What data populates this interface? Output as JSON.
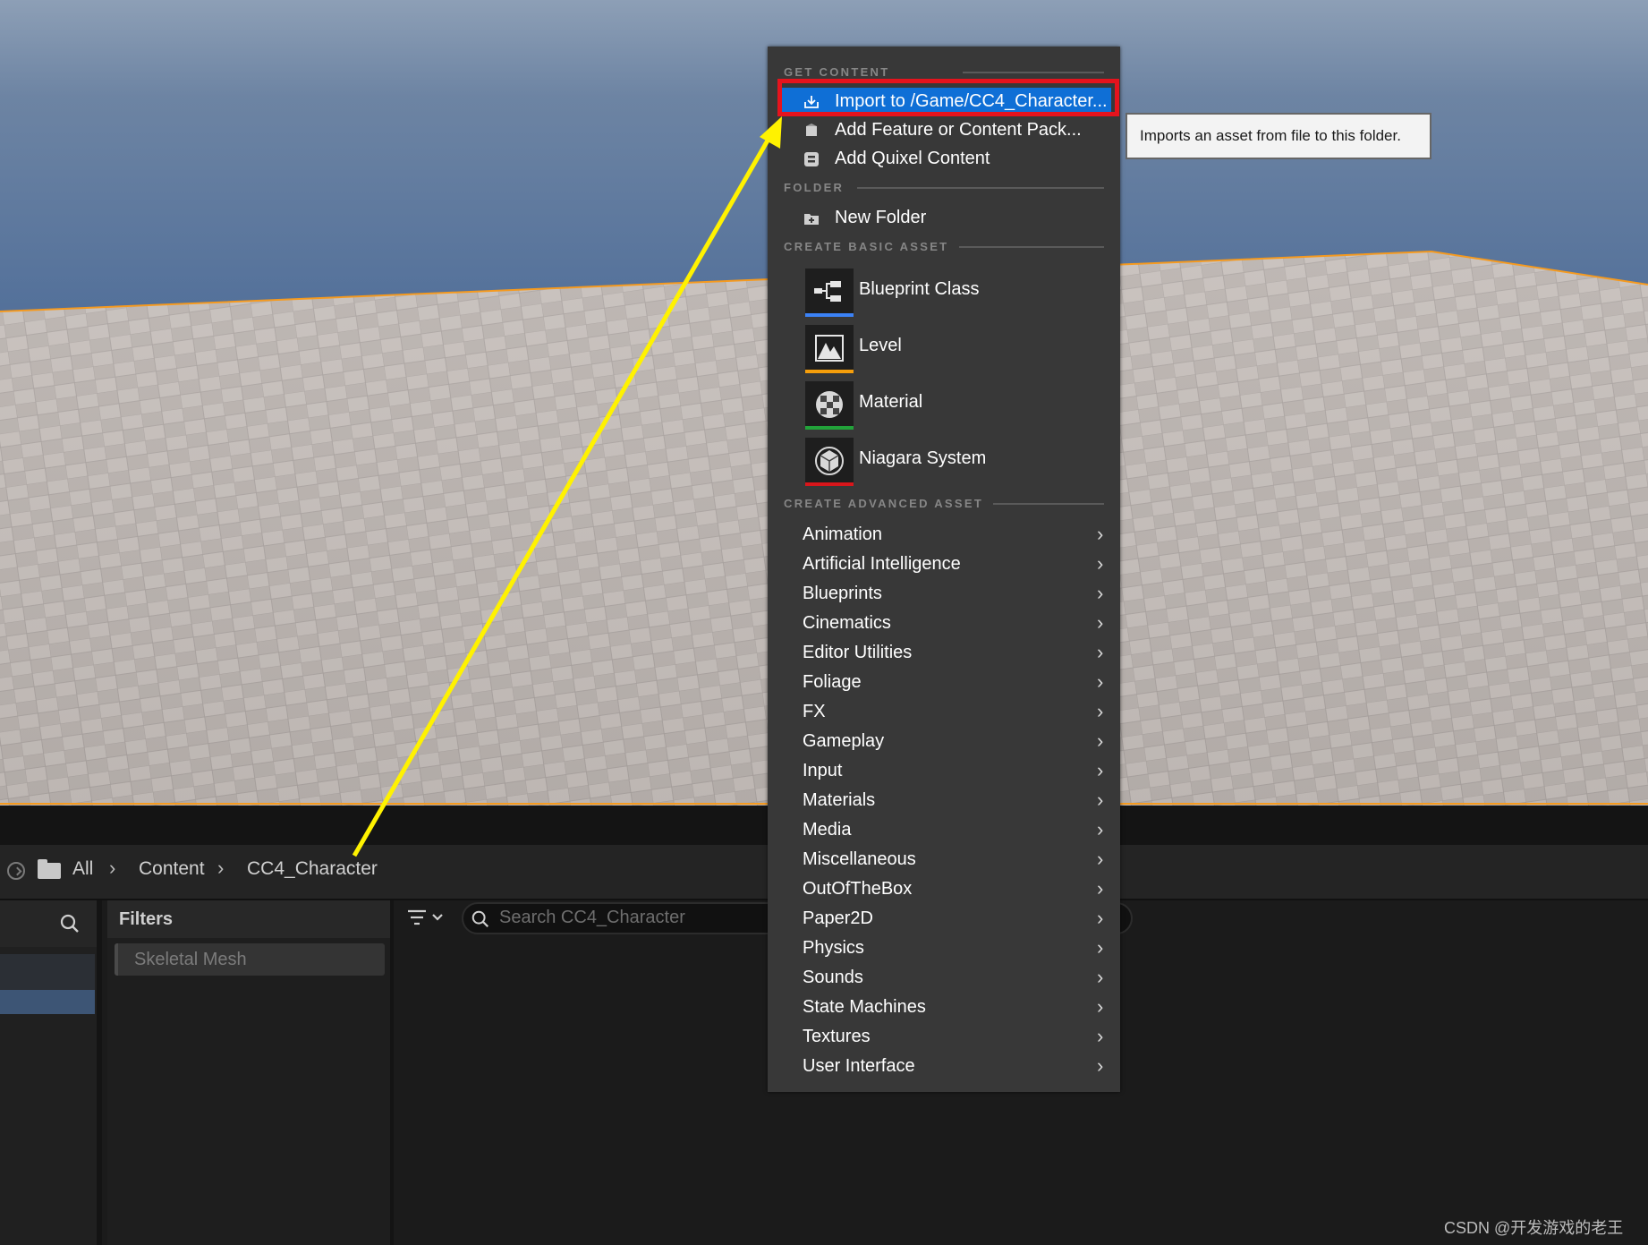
{
  "breadcrumb": {
    "items": [
      "All",
      "Content",
      "CC4_Character"
    ]
  },
  "filters": {
    "title": "Filters",
    "chip_label": "Skeletal Mesh"
  },
  "search": {
    "placeholder": "Search CC4_Character"
  },
  "context_menu": {
    "get_content_header": "GET CONTENT",
    "get_content": [
      {
        "label": "Import to /Game/CC4_Character...",
        "icon": "import-icon"
      },
      {
        "label": "Add Feature or Content Pack...",
        "icon": "content-pack-icon"
      },
      {
        "label": "Add Quixel Content",
        "icon": "quixel-icon"
      }
    ],
    "folder_header": "FOLDER",
    "folder": [
      {
        "label": "New Folder",
        "icon": "new-folder-icon"
      }
    ],
    "basic_asset_header": "CREATE BASIC ASSET",
    "basic_assets": [
      {
        "label": "Blueprint Class",
        "icon": "blueprint-class-icon",
        "color": "#3b82f6"
      },
      {
        "label": "Level",
        "icon": "level-icon",
        "color": "#f59e0b"
      },
      {
        "label": "Material",
        "icon": "material-icon",
        "color": "#22a33a"
      },
      {
        "label": "Niagara System",
        "icon": "niagara-icon",
        "color": "#d8161b"
      }
    ],
    "advanced_asset_header": "CREATE ADVANCED ASSET",
    "advanced_assets": [
      "Animation",
      "Artificial Intelligence",
      "Blueprints",
      "Cinematics",
      "Editor Utilities",
      "Foliage",
      "FX",
      "Gameplay",
      "Input",
      "Materials",
      "Media",
      "Miscellaneous",
      "OutOfTheBox",
      "Paper2D",
      "Physics",
      "Sounds",
      "State Machines",
      "Textures",
      "User Interface"
    ]
  },
  "tooltip": {
    "text": "Imports an asset from file to this folder."
  },
  "watermark": "CSDN @开发游戏的老王",
  "colors": {
    "highlight": "#0f6fd6",
    "annotation_box": "#e5131d",
    "annotation_arrow": "#fff200"
  }
}
